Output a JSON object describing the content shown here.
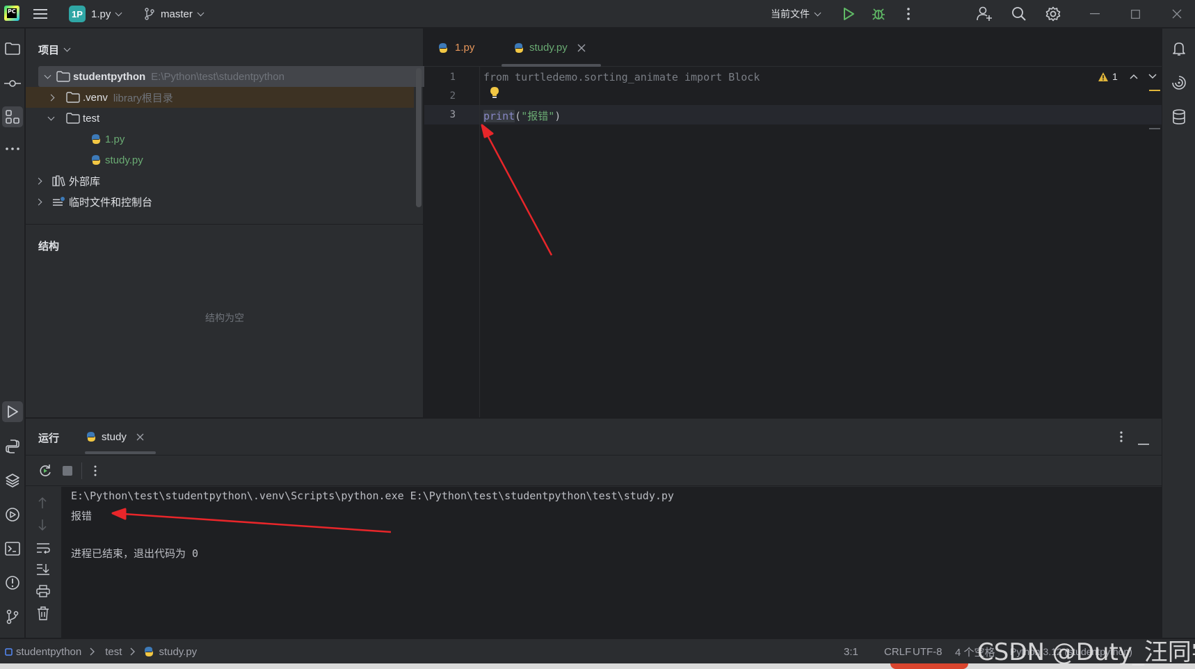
{
  "titlebar": {
    "project_badge": "1P",
    "current_file": "1.py",
    "branch": "master",
    "run_config": "当前文件"
  },
  "project_panel": {
    "title": "项目",
    "root_name": "studentpython",
    "root_path": "E:\\Python\\test\\studentpython",
    "venv_name": ".venv",
    "venv_hint": "library根目录",
    "test_folder": "test",
    "file_1": "1.py",
    "file_2": "study.py",
    "external_libs": "外部库",
    "scratches": "临时文件和控制台"
  },
  "structure": {
    "title": "结构",
    "empty_text": "结构为空"
  },
  "editor": {
    "tabs": [
      {
        "label": "1.py"
      },
      {
        "label": "study.py"
      }
    ],
    "line_numbers": [
      "1",
      "2",
      "3"
    ],
    "line1": "from turtledemo.sorting_animate import Block",
    "line3_fn": "print",
    "line3_open": "(",
    "line3_str": "\"报错\"",
    "line3_close": ")",
    "warning_count": "1"
  },
  "run": {
    "title": "运行",
    "tab_label": "study",
    "console_lines": [
      "E:\\Python\\test\\studentpython\\.venv\\Scripts\\python.exe E:\\Python\\test\\studentpython\\test\\study.py",
      "报错",
      "",
      "进程已结束，退出代码为 0"
    ]
  },
  "statusbar": {
    "crumb_project": "studentpython",
    "crumb_folder": "test",
    "crumb_file": "study.py",
    "position": "3:1",
    "line_sep": "CRLF",
    "encoding": "UTF-8",
    "indent": "4 个空格",
    "interpreter": "Python 3.12 (studentpython)"
  },
  "watermark": "CSDN @Duty_汪同学",
  "colors": {
    "accent_green": "#5fb865",
    "warning_yellow": "#e0b53a",
    "annotation_red": "#e8262a",
    "python_file_green": "#6aab73"
  }
}
